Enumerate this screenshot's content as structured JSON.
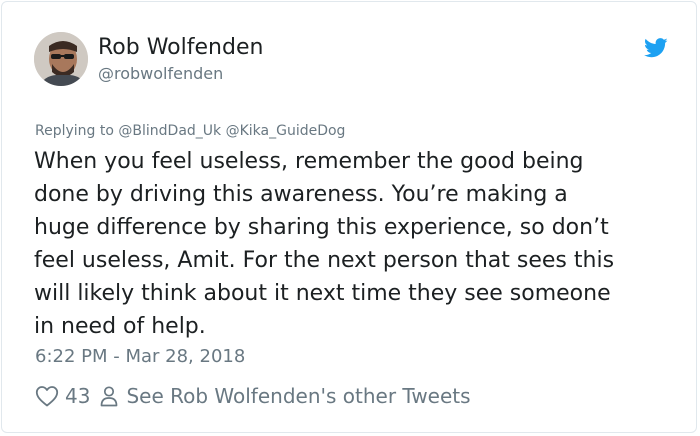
{
  "author": {
    "display_name": "Rob Wolfenden",
    "handle": "@robwolfenden"
  },
  "reply": {
    "prefix": "Replying to",
    "mentions": [
      "@BlindDad_Uk",
      "@Kika_GuideDog"
    ]
  },
  "tweet": {
    "text": "When you feel useless, remember the good being\ndone by driving this awareness. You’re making a\nhuge difference by sharing this experience, so don’t\nfeel useless, Amit. For the next person that sees this\nwill likely think about it next time they see someone\nin need of help.",
    "timestamp": "6:22 PM - Mar 28, 2018"
  },
  "actions": {
    "like_count": "43",
    "profile_link_label": "See Rob Wolfenden's other Tweets"
  },
  "icons": {
    "brand": "twitter-bird-icon",
    "like": "heart-icon",
    "profile": "person-icon"
  },
  "colors": {
    "brand_blue": "#1da1f2",
    "text_primary": "#1c2022",
    "text_secondary": "#697882",
    "border": "#e1e8ed"
  }
}
